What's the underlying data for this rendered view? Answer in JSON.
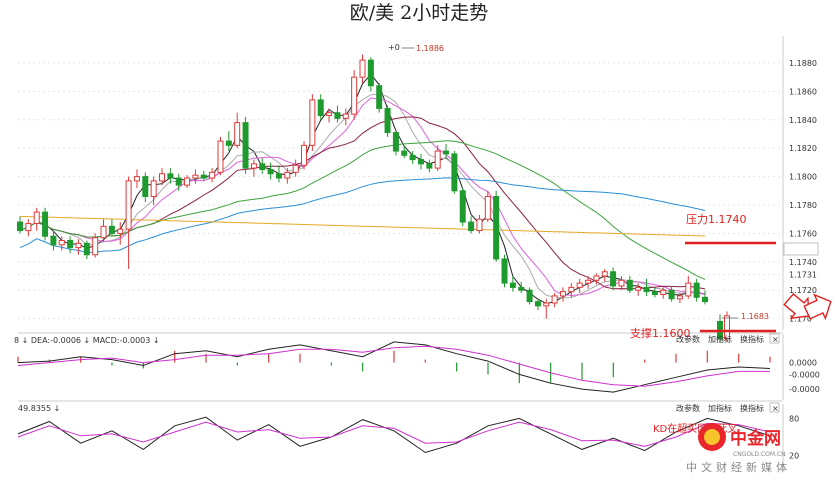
{
  "title": "欧/美 2小时走势",
  "colors": {
    "up": "#e03a3a",
    "down": "#1f9a2e",
    "ma_black": "#222222",
    "ma_gray": "#aaaaaa",
    "ma_magenta": "#e060e0",
    "ma_darkred": "#8c2040",
    "ma_green": "#3da33d",
    "ma_blue": "#2a8fd6",
    "ma_orange": "#e6a72a",
    "annotation": "#e02020"
  },
  "price_panel": {
    "y_ticks": [
      "1.1880",
      "1.1860",
      "1.1840",
      "1.1820",
      "1.1800",
      "1.1780",
      "1.1760",
      "1.1740",
      "1.1731",
      "1.1720",
      "1.170"
    ],
    "high_marker": "1.1886",
    "low_marker": "1.1683",
    "resistance_label": "压力1.1740",
    "support_label": "支撑1.1600"
  },
  "macd_panel": {
    "header": "8 ↓ DEA:-0.0006 ↓ MACD:-0.0003 ↓",
    "y_ticks": [
      "0.0000",
      "-0.0000",
      "-0.0000"
    ],
    "buttons": [
      "改参数",
      "加指标",
      "换指标",
      "×"
    ]
  },
  "kdj_panel": {
    "header": "49.8355 ↓",
    "y_ticks": [
      "80",
      "20"
    ],
    "buttons": [
      "改参数",
      "加指标",
      "换指标",
      "×"
    ],
    "annotation": "KD在超买区域死叉"
  },
  "watermark": {
    "brand": "中金网",
    "domain": "CNGOLD.COM.CN",
    "slogan": "中文财经新媒体"
  },
  "chart_data": {
    "type": "candlestick",
    "title": "欧/美 2小时走势",
    "y_range": [
      1.1692,
      1.1899
    ],
    "candles": [
      [
        1.1768,
        1.1772,
        1.176,
        1.1762
      ],
      [
        1.1762,
        1.177,
        1.1758,
        1.1767
      ],
      [
        1.1767,
        1.1778,
        1.1762,
        1.1775
      ],
      [
        1.1775,
        1.1778,
        1.1755,
        1.1758
      ],
      [
        1.1758,
        1.1762,
        1.1748,
        1.1752
      ],
      [
        1.1752,
        1.1758,
        1.1748,
        1.1755
      ],
      [
        1.1755,
        1.1758,
        1.1746,
        1.175
      ],
      [
        1.175,
        1.1756,
        1.1745,
        1.1753
      ],
      [
        1.1753,
        1.1755,
        1.1742,
        1.1745
      ],
      [
        1.1745,
        1.176,
        1.1743,
        1.1757
      ],
      [
        1.1757,
        1.177,
        1.1754,
        1.1765
      ],
      [
        1.1765,
        1.177,
        1.1758,
        1.176
      ],
      [
        1.176,
        1.1768,
        1.1752,
        1.1763
      ],
      [
        1.1763,
        1.18,
        1.1735,
        1.1797
      ],
      [
        1.1797,
        1.1805,
        1.1792,
        1.18
      ],
      [
        1.18,
        1.1803,
        1.1782,
        1.1786
      ],
      [
        1.1786,
        1.18,
        1.178,
        1.1797
      ],
      [
        1.1797,
        1.1806,
        1.1794,
        1.1802
      ],
      [
        1.1802,
        1.1806,
        1.1795,
        1.1799
      ],
      [
        1.1799,
        1.1802,
        1.179,
        1.1794
      ],
      [
        1.1794,
        1.1801,
        1.1792,
        1.1799
      ],
      [
        1.1799,
        1.1805,
        1.1795,
        1.1801
      ],
      [
        1.1801,
        1.1804,
        1.1797,
        1.1799
      ],
      [
        1.1799,
        1.1806,
        1.1796,
        1.1803
      ],
      [
        1.1803,
        1.1828,
        1.1801,
        1.1825
      ],
      [
        1.1825,
        1.1832,
        1.1818,
        1.1822
      ],
      [
        1.1822,
        1.1845,
        1.182,
        1.1838
      ],
      [
        1.1838,
        1.1842,
        1.1802,
        1.1806
      ],
      [
        1.1806,
        1.1812,
        1.18,
        1.1809
      ],
      [
        1.1809,
        1.1813,
        1.1802,
        1.1805
      ],
      [
        1.1805,
        1.181,
        1.1798,
        1.1802
      ],
      [
        1.1802,
        1.1808,
        1.1796,
        1.1799
      ],
      [
        1.1799,
        1.1806,
        1.1795,
        1.1803
      ],
      [
        1.1803,
        1.1812,
        1.18,
        1.1808
      ],
      [
        1.1808,
        1.1825,
        1.1805,
        1.1822
      ],
      [
        1.1822,
        1.1858,
        1.1818,
        1.1854
      ],
      [
        1.1854,
        1.1858,
        1.184,
        1.1843
      ],
      [
        1.1843,
        1.1848,
        1.1838,
        1.1845
      ],
      [
        1.1845,
        1.185,
        1.1838,
        1.1841
      ],
      [
        1.1841,
        1.1848,
        1.1836,
        1.1844
      ],
      [
        1.1844,
        1.1875,
        1.184,
        1.187
      ],
      [
        1.187,
        1.1886,
        1.1866,
        1.1882
      ],
      [
        1.1882,
        1.1884,
        1.186,
        1.1864
      ],
      [
        1.1864,
        1.1866,
        1.1845,
        1.1848
      ],
      [
        1.1848,
        1.185,
        1.1828,
        1.1831
      ],
      [
        1.1831,
        1.1832,
        1.1815,
        1.1818
      ],
      [
        1.1818,
        1.1822,
        1.1813,
        1.1815
      ],
      [
        1.1815,
        1.1818,
        1.1809,
        1.1812
      ],
      [
        1.1812,
        1.1816,
        1.1805,
        1.1809
      ],
      [
        1.1809,
        1.1812,
        1.1803,
        1.1806
      ],
      [
        1.1806,
        1.1822,
        1.1804,
        1.1818
      ],
      [
        1.1818,
        1.1823,
        1.1813,
        1.1816
      ],
      [
        1.1816,
        1.1818,
        1.1788,
        1.179
      ],
      [
        1.179,
        1.1792,
        1.1765,
        1.1768
      ],
      [
        1.1768,
        1.1772,
        1.176,
        1.1762
      ],
      [
        1.1762,
        1.1773,
        1.176,
        1.177
      ],
      [
        1.177,
        1.179,
        1.1768,
        1.1786
      ],
      [
        1.1786,
        1.179,
        1.174,
        1.1742
      ],
      [
        1.1742,
        1.1745,
        1.1722,
        1.1725
      ],
      [
        1.1725,
        1.173,
        1.1719,
        1.1722
      ],
      [
        1.1722,
        1.1726,
        1.1718,
        1.172
      ],
      [
        1.172,
        1.1722,
        1.171,
        1.1712
      ],
      [
        1.1712,
        1.1714,
        1.1706,
        1.1709
      ],
      [
        1.1709,
        1.1714,
        1.17,
        1.1711
      ],
      [
        1.1711,
        1.1718,
        1.1708,
        1.1716
      ],
      [
        1.1716,
        1.1722,
        1.1712,
        1.1719
      ],
      [
        1.1719,
        1.1725,
        1.1715,
        1.1722
      ],
      [
        1.1722,
        1.1728,
        1.1718,
        1.1725
      ],
      [
        1.1725,
        1.173,
        1.1721,
        1.1727
      ],
      [
        1.1727,
        1.1732,
        1.1724,
        1.173
      ],
      [
        1.173,
        1.1735,
        1.1726,
        1.1733
      ],
      [
        1.1733,
        1.1736,
        1.172,
        1.1723
      ],
      [
        1.1723,
        1.173,
        1.172,
        1.1727
      ],
      [
        1.1727,
        1.173,
        1.1718,
        1.172
      ],
      [
        1.172,
        1.1725,
        1.1716,
        1.1722
      ],
      [
        1.1722,
        1.1728,
        1.1716,
        1.1719
      ],
      [
        1.1719,
        1.1722,
        1.1715,
        1.1717
      ],
      [
        1.1717,
        1.1722,
        1.1714,
        1.172
      ],
      [
        1.172,
        1.1723,
        1.1712,
        1.1714
      ],
      [
        1.1714,
        1.1718,
        1.1711,
        1.1716
      ],
      [
        1.1716,
        1.173,
        1.1714,
        1.1725
      ],
      [
        1.1725,
        1.1728,
        1.1712,
        1.1715
      ],
      [
        1.1715,
        1.172,
        1.171,
        1.1712
      ]
    ],
    "trailing_candles": [
      [
        1.1698,
        1.1703,
        1.1683,
        1.1686
      ],
      [
        1.1686,
        1.1705,
        1.1684,
        1.1702
      ]
    ],
    "ma_periods": [
      "ma5",
      "ma10",
      "ma20",
      "ma30",
      "ma60",
      "ma120",
      "ma250"
    ],
    "macd_dif": [
      0.0,
      0.0001,
      0.0004,
      0.0002,
      -0.0002,
      0.0006,
      0.0008,
      0.0004,
      0.0009,
      0.0012,
      0.0008,
      0.0004,
      0.0014,
      0.0012,
      0.0006,
      0.0001,
      -0.0008,
      -0.0014,
      -0.0018,
      -0.002,
      -0.0015,
      -0.001,
      -0.0005,
      -0.0003,
      -0.0004
    ],
    "macd_dea": [
      -0.0002,
      0.0,
      0.0002,
      0.0003,
      0.0,
      0.0002,
      0.0005,
      0.0005,
      0.0006,
      0.0009,
      0.0009,
      0.0007,
      0.001,
      0.0011,
      0.0009,
      0.0005,
      -0.0001,
      -0.0007,
      -0.0012,
      -0.0015,
      -0.0016,
      -0.0013,
      -0.0009,
      -0.0006,
      -0.0006
    ],
    "kdj_k": [
      55,
      75,
      40,
      60,
      30,
      68,
      82,
      45,
      70,
      35,
      50,
      78,
      60,
      25,
      40,
      68,
      80,
      55,
      30,
      48,
      28,
      58,
      80,
      68,
      52
    ],
    "kdj_d": [
      50,
      68,
      52,
      55,
      42,
      58,
      74,
      58,
      62,
      48,
      50,
      68,
      64,
      40,
      42,
      60,
      74,
      62,
      44,
      45,
      35,
      50,
      72,
      70,
      58
    ]
  }
}
